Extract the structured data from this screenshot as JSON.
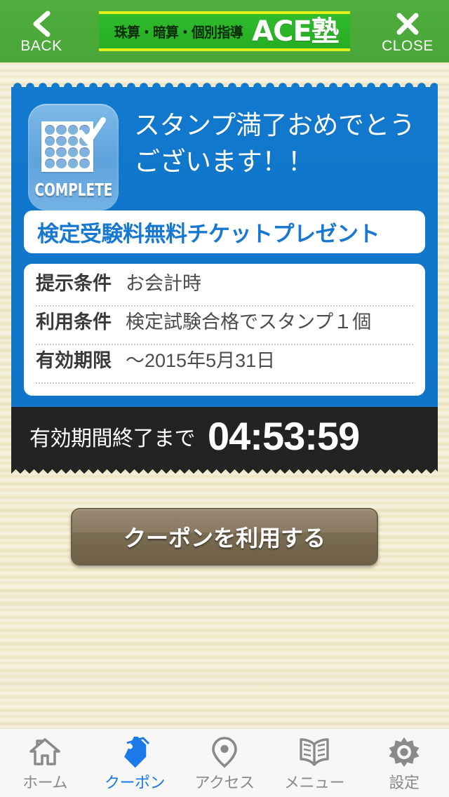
{
  "header": {
    "back_label": "BACK",
    "close_label": "CLOSE",
    "back_icon": "chevron-left-icon",
    "close_icon": "close-x-icon",
    "logo_sub": "珠算・暗算・個別指導",
    "logo_main": "ACE塾",
    "bar_color": "#4aab3a",
    "logo_bg_color": "#2eb82e",
    "logo_border_color": "#dff218"
  },
  "coupon": {
    "card_color": "#1179ce",
    "badge": {
      "icon": "stamp-card-complete-icon",
      "word": "COMPLETE",
      "dot_count": 16,
      "check_icon": "check-icon"
    },
    "congrats_line1": "スタンプ満了おめでとう",
    "congrats_line2": "ございます！！",
    "title": "検定受験料無料チケットプレゼント",
    "title_color": "#1678d0",
    "details": [
      {
        "label": "提示条件",
        "value": "お会計時"
      },
      {
        "label": "利用条件",
        "value": "検定試験合格でスタンプ１個"
      },
      {
        "label": "有効期限",
        "value": "〜2015年5月31日"
      }
    ],
    "countdown_label": "有効期間終了まで",
    "countdown_time": "04:53:59",
    "countdown_bg": "#232323"
  },
  "action": {
    "use_coupon_label": "クーポンを利用する"
  },
  "tabbar": {
    "active_color": "#1a7ae8",
    "inactive_color": "#8a8a8a",
    "items": [
      {
        "label": "ホーム",
        "icon": "home-icon",
        "active": false
      },
      {
        "label": "クーポン",
        "icon": "tag-icon",
        "active": true
      },
      {
        "label": "アクセス",
        "icon": "map-pin-icon",
        "active": false
      },
      {
        "label": "メニュー",
        "icon": "book-icon",
        "active": false
      },
      {
        "label": "設定",
        "icon": "gear-icon",
        "active": false
      }
    ]
  }
}
